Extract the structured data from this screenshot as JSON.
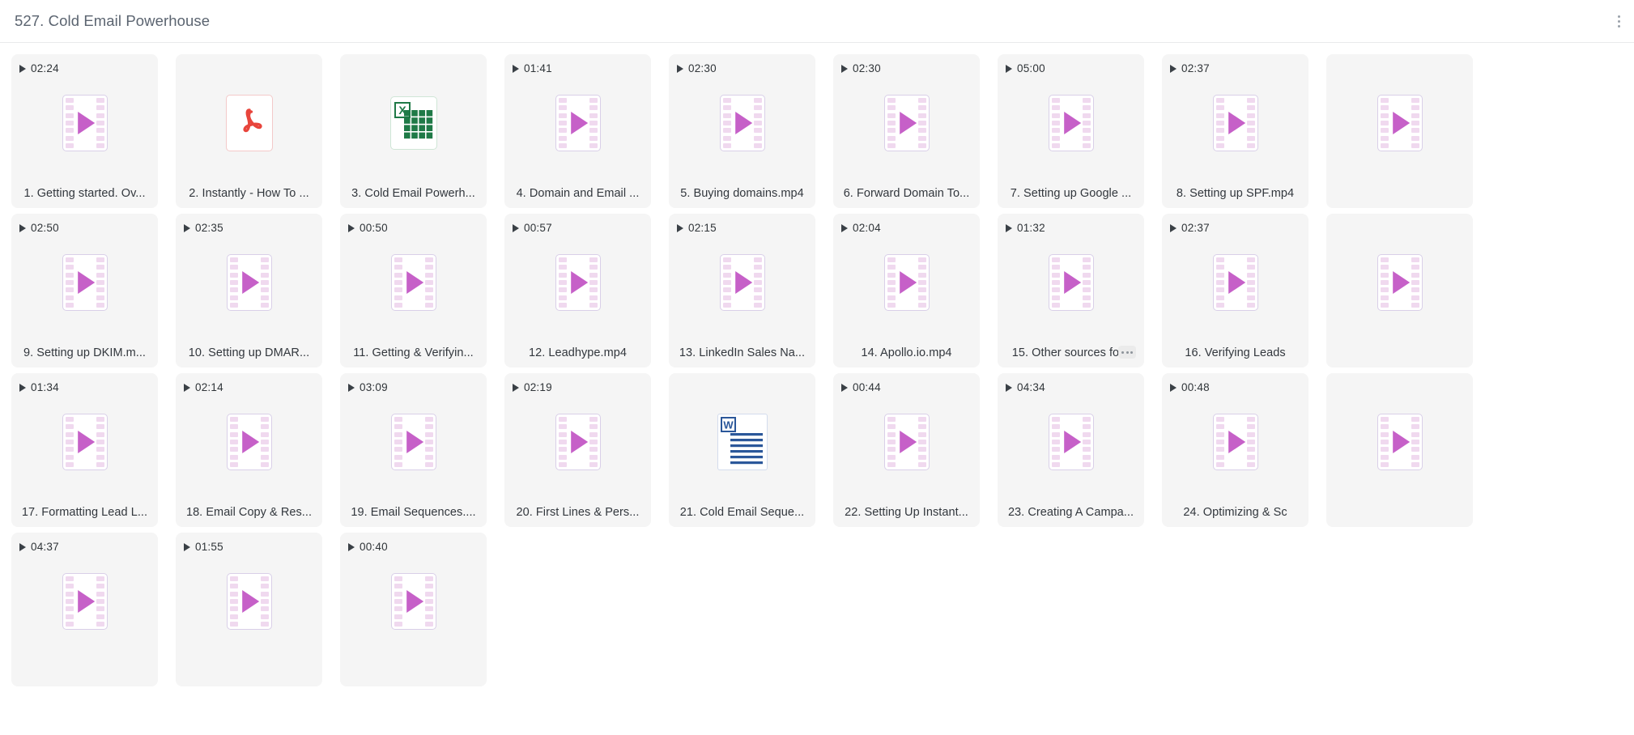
{
  "header": {
    "title": "527. Cold Email Powerhouse",
    "menu_icon": "kebab-menu-icon"
  },
  "grid": {
    "items": [
      {
        "duration": "02:24",
        "label": "1. Getting started. Ov...",
        "kind": "video",
        "menu": false
      },
      {
        "duration": "",
        "label": "2. Instantly - How To ...",
        "kind": "pdf",
        "menu": false
      },
      {
        "duration": "",
        "label": "3. Cold Email Powerh...",
        "kind": "excel",
        "menu": false
      },
      {
        "duration": "01:41",
        "label": "4. Domain and Email ...",
        "kind": "video",
        "menu": false
      },
      {
        "duration": "02:30",
        "label": "5. Buying domains.mp4",
        "kind": "video",
        "menu": false
      },
      {
        "duration": "02:30",
        "label": "6. Forward Domain To...",
        "kind": "video",
        "menu": false
      },
      {
        "duration": "05:00",
        "label": "7. Setting up Google ...",
        "kind": "video",
        "menu": false
      },
      {
        "duration": "02:37",
        "label": "8. Setting up SPF.mp4",
        "kind": "video",
        "menu": false
      },
      {
        "duration": "",
        "label": "",
        "kind": "video",
        "menu": false
      },
      {
        "duration": "02:50",
        "label": "9. Setting up DKIM.m...",
        "kind": "video",
        "menu": false
      },
      {
        "duration": "02:35",
        "label": "10. Setting up DMAR...",
        "kind": "video",
        "menu": false
      },
      {
        "duration": "00:50",
        "label": "11. Getting & Verifyin...",
        "kind": "video",
        "menu": false
      },
      {
        "duration": "00:57",
        "label": "12. Leadhype.mp4",
        "kind": "video",
        "menu": false
      },
      {
        "duration": "02:15",
        "label": "13. LinkedIn Sales Na...",
        "kind": "video",
        "menu": false
      },
      {
        "duration": "02:04",
        "label": "14. Apollo.io.mp4",
        "kind": "video",
        "menu": false
      },
      {
        "duration": "01:32",
        "label": "15. Other sources for .",
        "kind": "video",
        "menu": true
      },
      {
        "duration": "02:37",
        "label": "16. Verifying Leads",
        "kind": "video",
        "menu": false
      },
      {
        "duration": "",
        "label": "",
        "kind": "video",
        "menu": false
      },
      {
        "duration": "01:34",
        "label": "17. Formatting Lead L...",
        "kind": "video",
        "menu": false
      },
      {
        "duration": "02:14",
        "label": "18. Email Copy & Res...",
        "kind": "video",
        "menu": false
      },
      {
        "duration": "03:09",
        "label": "19. Email Sequences....",
        "kind": "video",
        "menu": false
      },
      {
        "duration": "02:19",
        "label": "20. First Lines & Pers...",
        "kind": "video",
        "menu": false
      },
      {
        "duration": "",
        "label": "21. Cold Email Seque...",
        "kind": "word",
        "menu": false
      },
      {
        "duration": "00:44",
        "label": "22. Setting Up Instant...",
        "kind": "video",
        "menu": false
      },
      {
        "duration": "04:34",
        "label": "23. Creating A Campa...",
        "kind": "video",
        "menu": false
      },
      {
        "duration": "00:48",
        "label": "24. Optimizing & Sc",
        "kind": "video",
        "menu": false
      },
      {
        "duration": "",
        "label": "",
        "kind": "video",
        "menu": false
      },
      {
        "duration": "04:37",
        "label": "",
        "kind": "video",
        "menu": false
      },
      {
        "duration": "01:55",
        "label": "",
        "kind": "video",
        "menu": false
      },
      {
        "duration": "00:40",
        "label": "",
        "kind": "video",
        "menu": false
      }
    ]
  },
  "colors": {
    "card_bg": "#f5f5f5",
    "play_accent": "#c660c8",
    "pdf_accent": "#e8453c",
    "excel_accent": "#1f7a47",
    "word_accent": "#2b579a",
    "title_text": "#5b6470",
    "caption_text": "#32373d"
  }
}
